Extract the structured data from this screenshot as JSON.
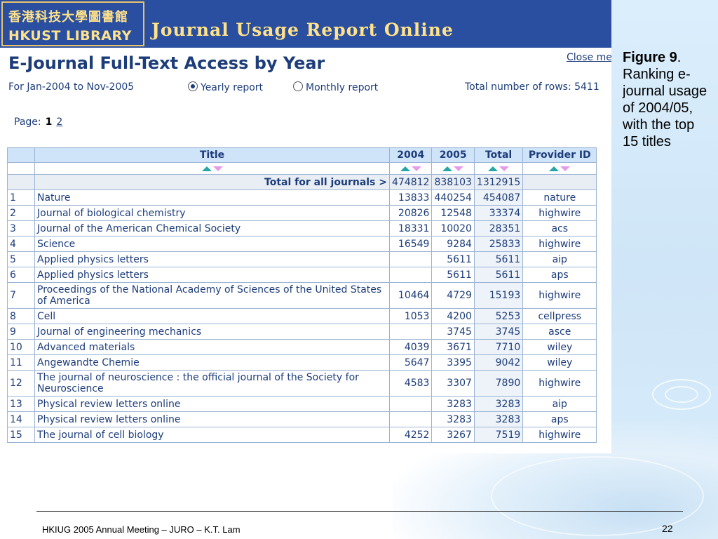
{
  "banner": {
    "logo_cn": "香港科技大學圖書館",
    "logo_en": "HKUST LIBRARY",
    "title": "Journal Usage Report Online"
  },
  "page": {
    "heading": "E-Journal Full-Text Access by Year",
    "close_link": "Close me",
    "period": "For Jan-2004 to Nov-2005",
    "radio_yearly": "Yearly report",
    "radio_monthly": "Monthly report",
    "selected_report": "yearly",
    "total_rows": "Total number of rows: 5411",
    "page_label": "Page:",
    "page_current": "1",
    "page_next": "2"
  },
  "table": {
    "headers": [
      "Title",
      "2004",
      "2005",
      "Total",
      "Provider ID"
    ],
    "total_label": "Total for all journals >",
    "total_2004": "474812",
    "total_2005": "838103",
    "total_total": "1312915",
    "rows": [
      {
        "rank": "1",
        "title": "Nature",
        "y2004": "13833",
        "y2005": "440254",
        "total": "454087",
        "provider": "nature"
      },
      {
        "rank": "2",
        "title": "Journal of biological chemistry",
        "y2004": "20826",
        "y2005": "12548",
        "total": "33374",
        "provider": "highwire"
      },
      {
        "rank": "3",
        "title": "Journal of the American Chemical Society",
        "y2004": "18331",
        "y2005": "10020",
        "total": "28351",
        "provider": "acs"
      },
      {
        "rank": "4",
        "title": "Science",
        "y2004": "16549",
        "y2005": "9284",
        "total": "25833",
        "provider": "highwire"
      },
      {
        "rank": "5",
        "title": "Applied physics letters",
        "y2004": "",
        "y2005": "5611",
        "total": "5611",
        "provider": "aip"
      },
      {
        "rank": "6",
        "title": "Applied physics letters",
        "y2004": "",
        "y2005": "5611",
        "total": "5611",
        "provider": "aps"
      },
      {
        "rank": "7",
        "title": "Proceedings of the National Academy of Sciences of the United States of America",
        "y2004": "10464",
        "y2005": "4729",
        "total": "15193",
        "provider": "highwire"
      },
      {
        "rank": "8",
        "title": "Cell",
        "y2004": "1053",
        "y2005": "4200",
        "total": "5253",
        "provider": "cellpress"
      },
      {
        "rank": "9",
        "title": "Journal of engineering mechanics",
        "y2004": "",
        "y2005": "3745",
        "total": "3745",
        "provider": "asce"
      },
      {
        "rank": "10",
        "title": "Advanced materials",
        "y2004": "4039",
        "y2005": "3671",
        "total": "7710",
        "provider": "wiley"
      },
      {
        "rank": "11",
        "title": "Angewandte Chemie",
        "y2004": "5647",
        "y2005": "3395",
        "total": "9042",
        "provider": "wiley"
      },
      {
        "rank": "12",
        "title": "The journal of neuroscience : the official journal of the Society for Neuroscience",
        "y2004": "4583",
        "y2005": "3307",
        "total": "7890",
        "provider": "highwire"
      },
      {
        "rank": "13",
        "title": "Physical review letters online",
        "y2004": "",
        "y2005": "3283",
        "total": "3283",
        "provider": "aip"
      },
      {
        "rank": "14",
        "title": "Physical review letters online",
        "y2004": "",
        "y2005": "3283",
        "total": "3283",
        "provider": "aps"
      },
      {
        "rank": "15",
        "title": "The journal of cell biology",
        "y2004": "4252",
        "y2005": "3267",
        "total": "7519",
        "provider": "highwire"
      }
    ]
  },
  "caption": {
    "figure": "Figure 9",
    "text": ". Ranking e-journal usage of 2004/05, with the top 15 titles"
  },
  "footer": {
    "left": "HKIUG 2005 Annual Meeting – JURO – K.T. Lam",
    "page_number": "22"
  },
  "colors": {
    "banner": "#2a4fa0",
    "banner_text": "#ffe28a",
    "link_text": "#1d3d7a",
    "header_fill": "#cfe3f9",
    "sort_up": "#26a6a6",
    "sort_down": "#e49be8"
  },
  "icons": [
    "sort-ascending-icon",
    "sort-descending-icon",
    "radio-icon"
  ]
}
